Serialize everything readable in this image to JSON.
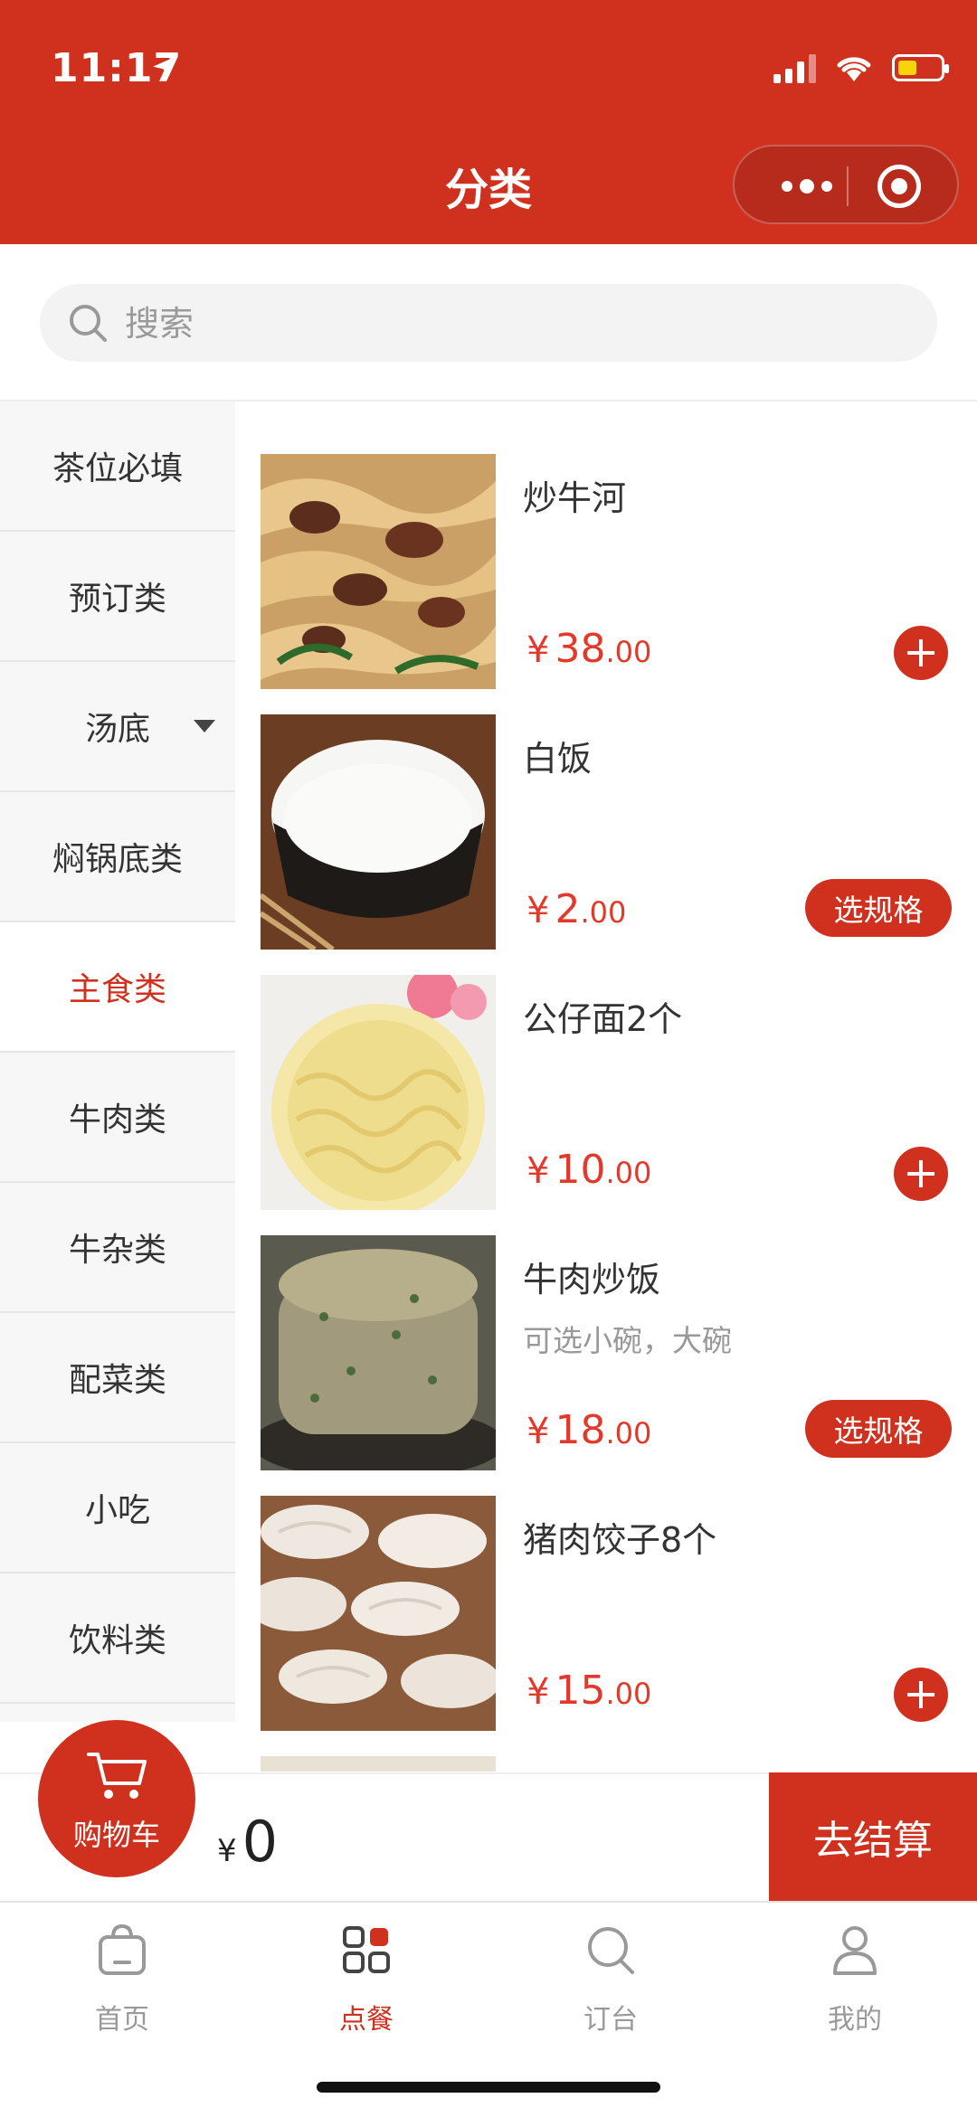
{
  "status_bar": {
    "time": "11:17"
  },
  "header": {
    "title": "分类"
  },
  "search": {
    "placeholder": "搜索"
  },
  "sidebar": {
    "items": [
      {
        "label": "茶位必填"
      },
      {
        "label": "预订类"
      },
      {
        "label": "汤底"
      },
      {
        "label": "焖锅底类"
      },
      {
        "label": "主食类"
      },
      {
        "label": "牛肉类"
      },
      {
        "label": "牛杂类"
      },
      {
        "label": "配菜类"
      },
      {
        "label": "小吃"
      },
      {
        "label": "饮料类"
      }
    ],
    "active_index": 4
  },
  "products": [
    {
      "name": "炒牛河",
      "desc": "",
      "currency": "¥",
      "price_int": "38",
      "price_dec": ".00",
      "action": "add"
    },
    {
      "name": "白饭",
      "desc": "",
      "currency": "¥",
      "price_int": "2",
      "price_dec": ".00",
      "action": "spec",
      "action_label": "选规格"
    },
    {
      "name": "公仔面2个",
      "desc": "",
      "currency": "¥",
      "price_int": "10",
      "price_dec": ".00",
      "action": "add"
    },
    {
      "name": "牛肉炒饭",
      "desc": "可选小碗，大碗",
      "currency": "¥",
      "price_int": "18",
      "price_dec": ".00",
      "action": "spec",
      "action_label": "选规格"
    },
    {
      "name": "猪肉饺子8个",
      "desc": "",
      "currency": "¥",
      "price_int": "15",
      "price_dec": ".00",
      "action": "add"
    }
  ],
  "cart": {
    "label": "购物车",
    "currency": "¥",
    "total": "0",
    "checkout_label": "去结算"
  },
  "tabbar": {
    "tabs": [
      {
        "label": "首页",
        "icon": "bag-icon"
      },
      {
        "label": "点餐",
        "icon": "grid-icon"
      },
      {
        "label": "订台",
        "icon": "search-icon"
      },
      {
        "label": "我的",
        "icon": "user-icon"
      }
    ],
    "active_index": 1
  },
  "colors": {
    "brand": "#d0311f",
    "price": "#e3392a"
  }
}
